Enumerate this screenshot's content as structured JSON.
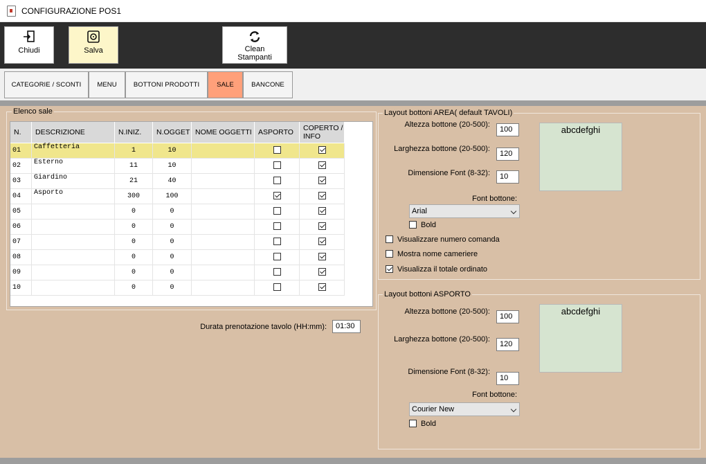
{
  "window": {
    "title": "CONFIGURAZIONE POS1"
  },
  "toolbar": {
    "chiudi": {
      "label": "Chiudi",
      "icon": "exit-door-icon"
    },
    "salva": {
      "label": "Salva",
      "icon": "save-disk-icon"
    },
    "clean": {
      "label_line1": "Clean",
      "label_line2": "Stampanti",
      "icon": "recycle-icon"
    }
  },
  "tabs": [
    {
      "label": "CATEGORIE / SCONTI",
      "active": false
    },
    {
      "label": "MENU",
      "active": false
    },
    {
      "label": "BOTTONI PRODOTTI",
      "active": false
    },
    {
      "label": "SALE",
      "active": true
    },
    {
      "label": "BANCONE",
      "active": false
    }
  ],
  "sale": {
    "group_label": "Elenco sale",
    "columns": [
      "N.",
      "DESCRIZIONE",
      "N.INIZ.",
      "N.OGGET",
      "NOME OGGETTI",
      "ASPORTO",
      "COPERTO / INFO"
    ],
    "rows": [
      {
        "n": "01",
        "descrizione": "Caffetteria",
        "iniz": "1",
        "ogget": "10",
        "nome": "",
        "asporto": false,
        "coperto": true,
        "selected": true
      },
      {
        "n": "02",
        "descrizione": "Esterno",
        "iniz": "11",
        "ogget": "10",
        "nome": "",
        "asporto": false,
        "coperto": true
      },
      {
        "n": "03",
        "descrizione": "Giardino",
        "iniz": "21",
        "ogget": "40",
        "nome": "",
        "asporto": false,
        "coperto": true
      },
      {
        "n": "04",
        "descrizione": "Asporto",
        "iniz": "300",
        "ogget": "100",
        "nome": "",
        "asporto": true,
        "coperto": true
      },
      {
        "n": "05",
        "descrizione": "",
        "iniz": "0",
        "ogget": "0",
        "nome": "",
        "asporto": false,
        "coperto": true
      },
      {
        "n": "06",
        "descrizione": "",
        "iniz": "0",
        "ogget": "0",
        "nome": "",
        "asporto": false,
        "coperto": true
      },
      {
        "n": "07",
        "descrizione": "",
        "iniz": "0",
        "ogget": "0",
        "nome": "",
        "asporto": false,
        "coperto": true
      },
      {
        "n": "08",
        "descrizione": "",
        "iniz": "0",
        "ogget": "0",
        "nome": "",
        "asporto": false,
        "coperto": true
      },
      {
        "n": "09",
        "descrizione": "",
        "iniz": "0",
        "ogget": "0",
        "nome": "",
        "asporto": false,
        "coperto": true
      },
      {
        "n": "10",
        "descrizione": "",
        "iniz": "0",
        "ogget": "0",
        "nome": "",
        "asporto": false,
        "coperto": true
      }
    ],
    "durata_label": "Durata prenotazione tavolo (HH:mm):",
    "durata_value": "01:30"
  },
  "area": {
    "group_label": "Layout bottoni AREA( default TAVOLI)",
    "altezza_label": "Altezza bottone (20-500):",
    "altezza_value": "100",
    "larghezza_label": "Larghezza bottone (20-500):",
    "larghezza_value": "120",
    "font_size_label": "Dimensione Font (8-32):",
    "font_size_value": "10",
    "preview_text": "abcdefghi",
    "font_label": "Font bottone:",
    "font_value": "Arial",
    "bold_label": "Bold",
    "bold": false,
    "opt_numero_label": "Visualizzare numero comanda",
    "opt_numero": false,
    "opt_camerieri_label": "Mostra nome cameriere",
    "opt_camerieri": false,
    "opt_totale_label": "Visualizza il totale ordinato",
    "opt_totale": true
  },
  "asporto": {
    "group_label": "Layout bottoni ASPORTO",
    "altezza_label": "Altezza bottone (20-500):",
    "altezza_value": "100",
    "larghezza_label": "Larghezza bottone (20-500):",
    "larghezza_value": "120",
    "font_size_label": "Dimensione Font (8-32):",
    "font_size_value": "10",
    "preview_text": "abcdefghi",
    "font_label": "Font bottone:",
    "font_value": "Courier New",
    "bold_label": "Bold",
    "bold": false
  },
  "colors": {
    "panel_bg": "#d8bfa6",
    "active_tab": "#ffa07a",
    "selected_row": "#f0e68c",
    "preview_bg": "#d6e4d0",
    "salva_bg": "#fdf6c9",
    "toolbar_bg": "#2d2d2d"
  }
}
